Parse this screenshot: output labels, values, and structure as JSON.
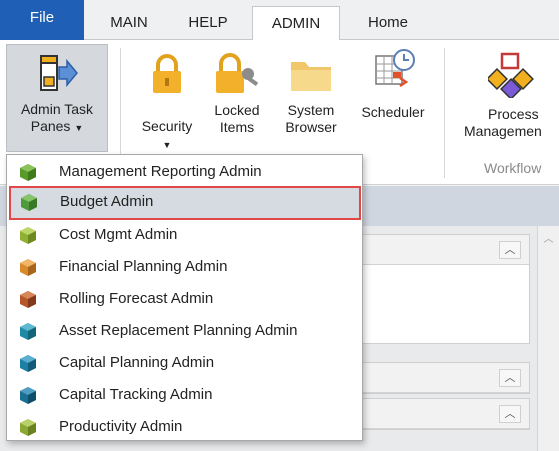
{
  "tabs": {
    "file": "File",
    "main": "MAIN",
    "help": "HELP",
    "admin": "ADMIN",
    "home": "Home"
  },
  "ribbon": {
    "admin_task_panes": {
      "line1": "Admin Task",
      "line2": "Panes"
    },
    "security": "Security",
    "locked_items": {
      "line1": "Locked",
      "line2": "Items"
    },
    "system_browser": {
      "line1": "System",
      "line2": "Browser"
    },
    "scheduler": "Scheduler",
    "process_management": {
      "line1": "Process",
      "line2": "Managemen"
    },
    "workflow_group": "Workflow"
  },
  "menu": {
    "items": [
      {
        "label": "Management Reporting Admin",
        "icon": "green-cube-icon",
        "color": "#5a9a2a"
      },
      {
        "label": "Budget Admin",
        "icon": "green-cube-icon",
        "color": "#4f9a3a",
        "selected": true
      },
      {
        "label": "Cost Mgmt Admin",
        "icon": "olive-cube-icon",
        "color": "#8fb032"
      },
      {
        "label": "Financial Planning Admin",
        "icon": "orange-cube-icon",
        "color": "#d98a2a"
      },
      {
        "label": "Rolling Forecast Admin",
        "icon": "brown-cube-icon",
        "color": "#b5572a"
      },
      {
        "label": "Asset Replacement Planning Admin",
        "icon": "teal-cube-icon",
        "color": "#1f8aa6"
      },
      {
        "label": "Capital Planning Admin",
        "icon": "teal-cube-icon",
        "color": "#1d7fa3"
      },
      {
        "label": "Capital Tracking Admin",
        "icon": "teal-cube-icon",
        "color": "#1b6f93"
      },
      {
        "label": "Productivity Admin",
        "icon": "olive-cube-icon",
        "color": "#8aa832"
      }
    ]
  },
  "colors": {
    "file_tab": "#1f5fb5",
    "selection_border": "#e04848",
    "selection_fill": "#d6dbe1"
  }
}
